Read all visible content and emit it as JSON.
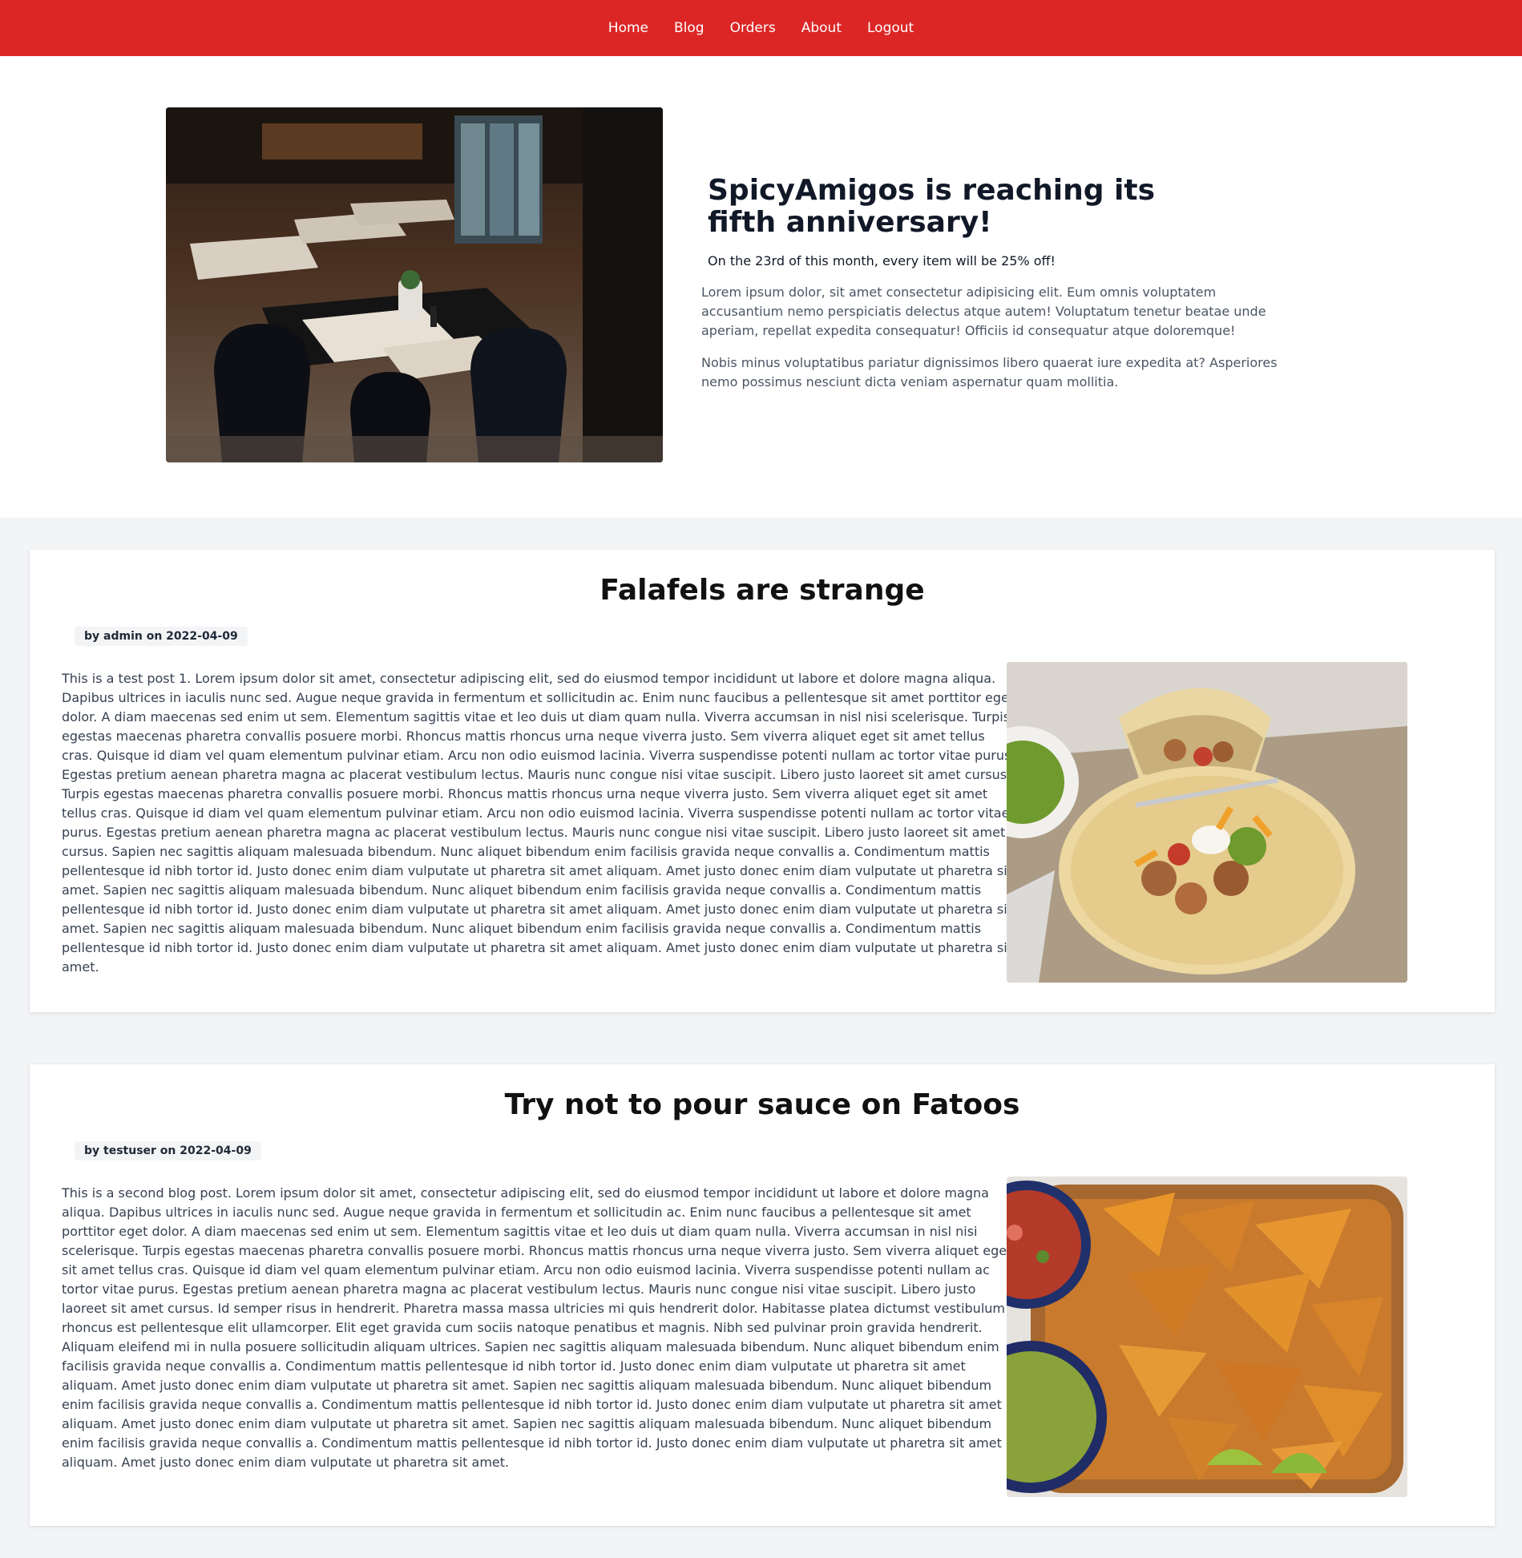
{
  "nav": {
    "items": [
      "Home",
      "Blog",
      "Orders",
      "About",
      "Logout"
    ]
  },
  "hero": {
    "image_alt": "restaurant-interior",
    "title": "SpicyAmigos is reaching its fifth anniversary!",
    "subtitle": "On the 23rd of this month, every item will be 25% off!",
    "paragraphs": [
      "Lorem ipsum dolor, sit amet consectetur adipisicing elit. Eum omnis voluptatem accusantium nemo perspiciatis delectus atque autem! Voluptatum tenetur beatae unde aperiam, repellat expedita consequatur! Officiis id consequatur atque doloremque!",
      "Nobis minus voluptatibus pariatur dignissimos libero quaerat iure expedita at? Asperiores nemo possimus nesciunt dicta veniam aspernatur quam mollitia."
    ]
  },
  "posts": [
    {
      "title": "Falafels are strange",
      "meta": "by admin on 2022-04-09",
      "body": "This is a test post 1. Lorem ipsum dolor sit amet, consectetur adipiscing elit, sed do eiusmod tempor incididunt ut labore et dolore magna aliqua. Dapibus ultrices in iaculis nunc sed. Augue neque gravida in fermentum et sollicitudin ac. Enim nunc faucibus a pellentesque sit amet porttitor eget dolor. A diam maecenas sed enim ut sem. Elementum sagittis vitae et leo duis ut diam quam nulla. Viverra accumsan in nisl nisi scelerisque. Turpis egestas maecenas pharetra convallis posuere morbi. Rhoncus mattis rhoncus urna neque viverra justo. Sem viverra aliquet eget sit amet tellus cras. Quisque id diam vel quam elementum pulvinar etiam. Arcu non odio euismod lacinia. Viverra suspendisse potenti nullam ac tortor vitae purus. Egestas pretium aenean pharetra magna ac placerat vestibulum lectus. Mauris nunc congue nisi vitae suscipit. Libero justo laoreet sit amet cursus. Turpis egestas maecenas pharetra convallis posuere morbi. Rhoncus mattis rhoncus urna neque viverra justo. Sem viverra aliquet eget sit amet tellus cras. Quisque id diam vel quam elementum pulvinar etiam. Arcu non odio euismod lacinia. Viverra suspendisse potenti nullam ac tortor vitae purus. Egestas pretium aenean pharetra magna ac placerat vestibulum lectus. Mauris nunc congue nisi vitae suscipit. Libero justo laoreet sit amet cursus. Sapien nec sagittis aliquam malesuada bibendum. Nunc aliquet bibendum enim facilisis gravida neque convallis a. Condimentum mattis pellentesque id nibh tortor id. Justo donec enim diam vulputate ut pharetra sit amet aliquam. Amet justo donec enim diam vulputate ut pharetra sit amet. Sapien nec sagittis aliquam malesuada bibendum. Nunc aliquet bibendum enim facilisis gravida neque convallis a. Condimentum mattis pellentesque id nibh tortor id. Justo donec enim diam vulputate ut pharetra sit amet aliquam. Amet justo donec enim diam vulputate ut pharetra sit amet. Sapien nec sagittis aliquam malesuada bibendum. Nunc aliquet bibendum enim facilisis gravida neque convallis a. Condimentum mattis pellentesque id nibh tortor id. Justo donec enim diam vulputate ut pharetra sit amet aliquam. Amet justo donec enim diam vulputate ut pharetra sit amet.",
      "image_alt": "fajita-tacos"
    },
    {
      "title": "Try not to pour sauce on Fatoos",
      "meta": "by testuser on 2022-04-09",
      "body": "This is a second blog post. Lorem ipsum dolor sit amet, consectetur adipiscing elit, sed do eiusmod tempor incididunt ut labore et dolore magna aliqua. Dapibus ultrices in iaculis nunc sed. Augue neque gravida in fermentum et sollicitudin ac. Enim nunc faucibus a pellentesque sit amet porttitor eget dolor. A diam maecenas sed enim ut sem. Elementum sagittis vitae et leo duis ut diam quam nulla. Viverra accumsan in nisl nisi scelerisque. Turpis egestas maecenas pharetra convallis posuere morbi. Rhoncus mattis rhoncus urna neque viverra justo. Sem viverra aliquet eget sit amet tellus cras. Quisque id diam vel quam elementum pulvinar etiam. Arcu non odio euismod lacinia. Viverra suspendisse potenti nullam ac tortor vitae purus. Egestas pretium aenean pharetra magna ac placerat vestibulum lectus. Mauris nunc congue nisi vitae suscipit. Libero justo laoreet sit amet cursus. Id semper risus in hendrerit. Pharetra massa massa ultricies mi quis hendrerit dolor. Habitasse platea dictumst vestibulum rhoncus est pellentesque elit ullamcorper. Elit eget gravida cum sociis natoque penatibus et magnis. Nibh sed pulvinar proin gravida hendrerit. Aliquam eleifend mi in nulla posuere sollicitudin aliquam ultrices. Sapien nec sagittis aliquam malesuada bibendum. Nunc aliquet bibendum enim facilisis gravida neque convallis a. Condimentum mattis pellentesque id nibh tortor id. Justo donec enim diam vulputate ut pharetra sit amet aliquam. Amet justo donec enim diam vulputate ut pharetra sit amet. Sapien nec sagittis aliquam malesuada bibendum. Nunc aliquet bibendum enim facilisis gravida neque convallis a. Condimentum mattis pellentesque id nibh tortor id. Justo donec enim diam vulputate ut pharetra sit amet aliquam. Amet justo donec enim diam vulputate ut pharetra sit amet. Sapien nec sagittis aliquam malesuada bibendum. Nunc aliquet bibendum enim facilisis gravida neque convallis a. Condimentum mattis pellentesque id nibh tortor id. Justo donec enim diam vulputate ut pharetra sit amet aliquam. Amet justo donec enim diam vulputate ut pharetra sit amet.",
      "image_alt": "tortilla-chips-with-salsa-and-guacamole"
    }
  ],
  "colors": {
    "nav_bg": "#dc2626",
    "page_bg": "#f3f4f6",
    "card_bg": "#ffffff"
  }
}
